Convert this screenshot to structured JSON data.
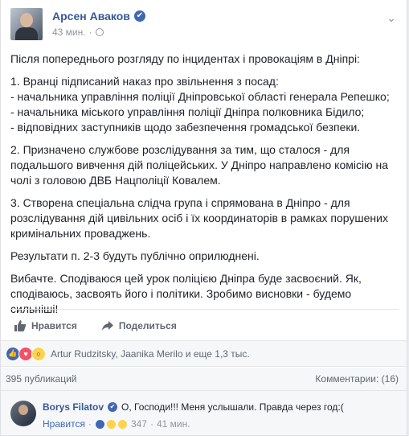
{
  "post": {
    "author": "Арсен Аваков",
    "time": "43 мин.",
    "paragraphs": [
      [
        "Після попереднього розгляду по інцидентах і провокаціям в Дніпрі:"
      ],
      [
        "1. Вранці підписаний наказ про звільнення з посад:",
        "- начальника управління поліції Дніпровської області генерала Репешко;",
        "- начальника міського управління поліції Дніпра полковника Бідило;",
        "- відповідних заступників щодо забезпечення громадської безпеки."
      ],
      [
        "2. Призначено службове розслідування за тим, що сталося - для",
        "подальшого вивчення дій поліцейських. У Дніпро направлено комісію на",
        "чолі з головою ДВБ Нацполіції Ковалем."
      ],
      [
        "3. Створена спеціальна слідча група і спрямована в Дніпро - для",
        "розслідування дій цивільних осіб і їх координаторів в рамках порушених",
        "кримінальних проваджень."
      ],
      [
        "Результати п. 2-3 будуть публічно оприлюднені."
      ],
      [
        "Вибачте. Сподіваюся цей урок поліцією Дніпра буде засвоєний. Як,",
        "сподіваюсь, засвоять його і політики. Зробимо висновки - будемо",
        "сильніші!"
      ]
    ]
  },
  "actions": {
    "like": "Нравится",
    "share": "Поделиться"
  },
  "reactions": {
    "names": "Artur Rudzitsky, Jaanika Merilo и еще 1,3 тыс."
  },
  "stats": {
    "shares": "395 публикаций",
    "comments": "Комментарии: (16)"
  },
  "comment": {
    "author": "Borys Filatov",
    "text": "О, Господи!!! Меня услышали. Правда через год:(",
    "like": "Нравится",
    "reaction_count": "347",
    "time": "41 мин."
  },
  "colors": {
    "link": "#365899",
    "accent": "#4267b2"
  }
}
